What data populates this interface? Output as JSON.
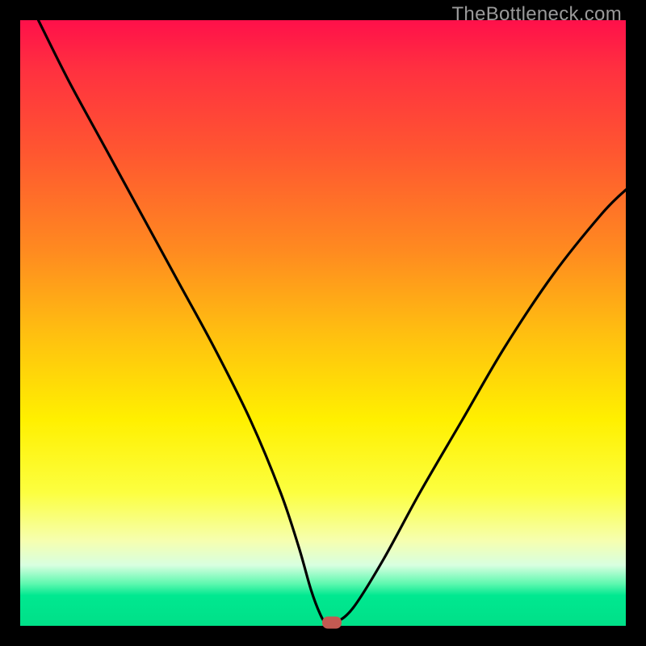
{
  "watermark": "TheBottleneck.com",
  "chart_data": {
    "type": "line",
    "title": "",
    "xlabel": "",
    "ylabel": "",
    "xlim": [
      0,
      100
    ],
    "ylim": [
      0,
      100
    ],
    "series": [
      {
        "name": "bottleneck-curve",
        "x": [
          3,
          8,
          14,
          20,
          26,
          32,
          38,
          43,
          46,
          48,
          49.5,
          50.5,
          52,
          55,
          60,
          66,
          73,
          80,
          88,
          96,
          100
        ],
        "y": [
          100,
          90,
          79,
          68,
          57,
          46,
          34,
          22,
          13,
          6,
          2,
          0.5,
          0.5,
          3,
          11,
          22,
          34,
          46,
          58,
          68,
          72
        ]
      }
    ],
    "flat_segment": {
      "x_start": 46.5,
      "x_end": 52,
      "y": 0.5
    },
    "marker": {
      "x": 51.5,
      "y": 0.5,
      "color": "#c35a52"
    },
    "background_gradient": {
      "stops": [
        {
          "pos": 0,
          "color": "#ff104a"
        },
        {
          "pos": 22,
          "color": "#ff5730"
        },
        {
          "pos": 52,
          "color": "#ffc010"
        },
        {
          "pos": 78,
          "color": "#fcff40"
        },
        {
          "pos": 93,
          "color": "#60f8b0"
        },
        {
          "pos": 100,
          "color": "#00e088"
        }
      ]
    }
  }
}
